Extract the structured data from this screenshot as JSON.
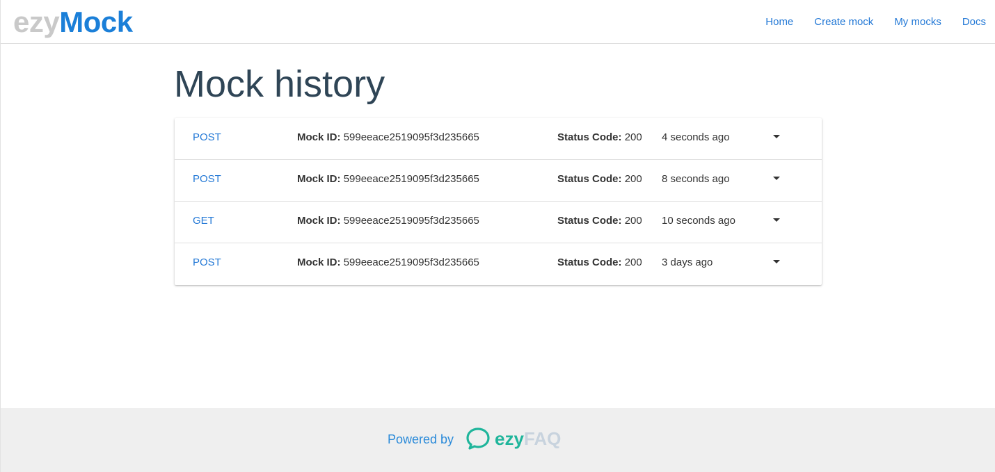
{
  "header": {
    "logo": {
      "part1": "ezy",
      "part2": "Mock"
    },
    "nav": [
      "Home",
      "Create mock",
      "My mocks",
      "Docs"
    ]
  },
  "main": {
    "title": "Mock history",
    "mock_id_label": "Mock ID:",
    "status_label": "Status Code:",
    "rows": [
      {
        "method": "POST",
        "mock_id": "599eeace2519095f3d235665",
        "status_code": "200",
        "time": "4 seconds ago"
      },
      {
        "method": "POST",
        "mock_id": "599eeace2519095f3d235665",
        "status_code": "200",
        "time": "8 seconds ago"
      },
      {
        "method": "GET",
        "mock_id": "599eeace2519095f3d235665",
        "status_code": "200",
        "time": "10 seconds ago"
      },
      {
        "method": "POST",
        "mock_id": "599eeace2519095f3d235665",
        "status_code": "200",
        "time": "3 days ago"
      }
    ]
  },
  "footer": {
    "powered_by": "Powered by",
    "brand_part1": "ezy",
    "brand_part2": "FAQ",
    "icon": "chat-bubble-icon"
  },
  "colors": {
    "accent": "#2479d6",
    "logo_grey": "#c9c9c9",
    "logo_blue": "#1b7fd8",
    "title": "#2f4556",
    "footer_bg": "#efefef",
    "ezyfaq_green": "#1fb59b",
    "ezyfaq_grey": "#c8d3de"
  }
}
